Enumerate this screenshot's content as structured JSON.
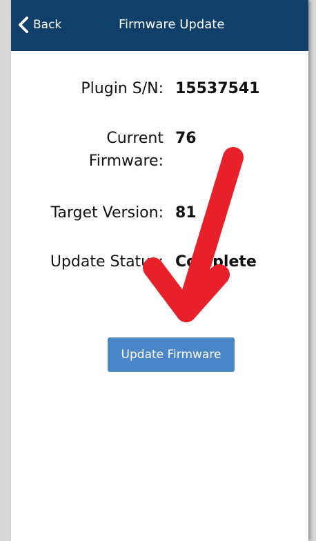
{
  "navbar": {
    "back_label": "Back",
    "title": "Firmware Update",
    "color": "#103f6b"
  },
  "details": {
    "serial_label": "Plugin S/N:",
    "serial_value": "15537541",
    "current_label_line1": "Current",
    "current_label_line2": "Firmware:",
    "current_value": "76",
    "target_label": "Target Version:",
    "target_value": "81",
    "status_label": "Update Status:",
    "status_value": "Complete"
  },
  "action": {
    "update_label": "Update Firmware",
    "color": "#4a86c8"
  },
  "annotation": {
    "type": "arrow",
    "color": "#e8202a"
  }
}
